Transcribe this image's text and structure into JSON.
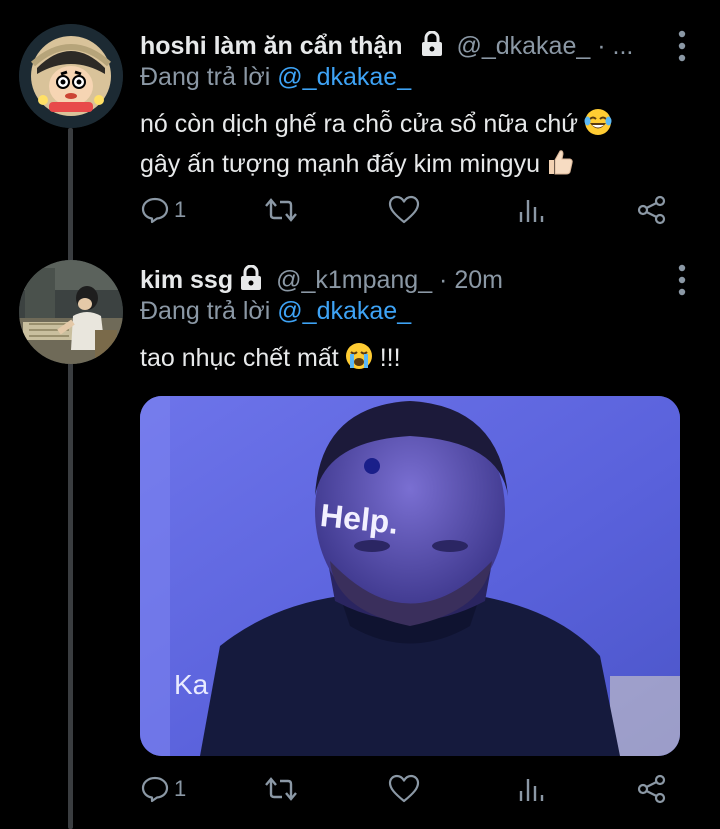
{
  "tweets": [
    {
      "display_name": "hoshi làm ăn cẩn thận",
      "handle": "@_dkakae_",
      "separator": "·",
      "time": "...",
      "reply_prefix": "Đang trả lời",
      "reply_to": "@_dkakae_",
      "text_line1": "nó còn dịch ghế ra chỗ cửa sổ nữa chứ",
      "text_line2": "gây ấn tượng mạnh đấy kim mingyu",
      "reply_count": "1",
      "avatar_icon": "cartoon-boy-avatar",
      "emojis": [
        "laughing-crying-emoji",
        "thumbs-up-emoji"
      ]
    },
    {
      "display_name": "kim ssg",
      "handle": "@_k1mpang_",
      "separator": "·",
      "time": "20m",
      "reply_prefix": "Đang trả lời",
      "reply_to": "@_dkakae_",
      "text_main": "tao nhục chết mất",
      "text_suffix": "!!!",
      "reply_count": "1",
      "avatar_icon": "anime-person-at-desk-avatar",
      "emojis": [
        "loudly-crying-emoji"
      ],
      "media": {
        "forehead_text": "Help.",
        "corner_text": "Ka"
      }
    }
  ],
  "colors": {
    "background": "#000000",
    "text_primary": "#e7e9ea",
    "text_secondary": "#8b98a5",
    "link": "#3ea3f5",
    "thread_line": "#3a3d40"
  }
}
